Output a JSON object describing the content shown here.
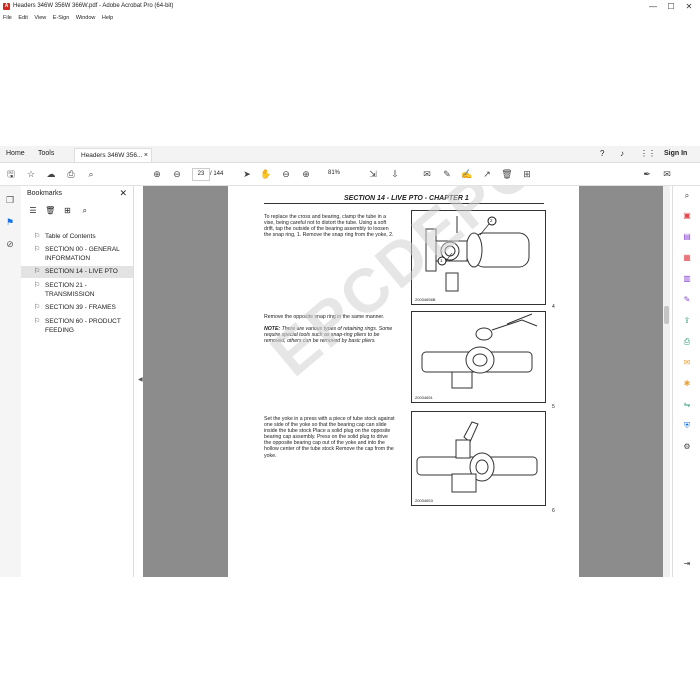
{
  "window": {
    "title": "Headers 346W 356W 366W.pdf - Adobe Acrobat Pro (64-bit)",
    "app_icon": "acrobat-icon",
    "controls": [
      "—",
      "☐",
      "✕"
    ]
  },
  "menu": [
    "File",
    "Edit",
    "View",
    "E-Sign",
    "Window",
    "Help"
  ],
  "tabs": {
    "home": "Home",
    "tools": "Tools",
    "document": "Headers 346W 356...",
    "close": "×",
    "sign_in": "Sign In"
  },
  "toolbar": {
    "page_current": "23",
    "page_total": "/ 144",
    "zoom": "81%"
  },
  "bookmarks": {
    "title": "Bookmarks",
    "close": "✕",
    "items": [
      {
        "label": "Table of Contents"
      },
      {
        "label": "SECTION 00 - GENERAL INFORMATION"
      },
      {
        "label": "SECTION 14 - LIVE PTO"
      },
      {
        "label": "SECTION 21 - TRANSMISSION"
      },
      {
        "label": "SECTION 39 - FRAMES"
      },
      {
        "label": "SECTION 60 - PRODUCT FEEDING"
      }
    ],
    "selected_index": 2
  },
  "document": {
    "header": "SECTION 14 - LIVE PTO - CHAPTER 1",
    "watermark": "EPCDEPO.COM",
    "step1": "To replace the cross and bearing, clamp the tube in a vise, being careful not to distort the tube. Using a soft drift, tap the outside of the bearing assembly to loosen the snap ring, 1. Remove the snap ring from the yoke, 2.",
    "step2": "Remove the opposite snap ring in the same manner.",
    "note_label": "NOTE:",
    "note_text": "There are various types of retaining rings. Some require special tools such as snap-ring pliers to be removed, others can be removed by basic pliers.",
    "step3": "Set the yoke in a press with a piece of tube stock against one side of the yoke so that the bearing cap can slide inside the tube stock Place a solid plug on the opposite bearing cap assembly. Press on the solid plug to drive the opposite bearing cap out of the yoke and into the hollow center of the tube stock Remove the cap from the yoke.",
    "figures": [
      {
        "id": "20034656B",
        "number": "4",
        "callouts": [
          "1",
          "2"
        ]
      },
      {
        "id": "20034651",
        "number": "5"
      },
      {
        "id": "20034653",
        "number": "6"
      }
    ]
  }
}
